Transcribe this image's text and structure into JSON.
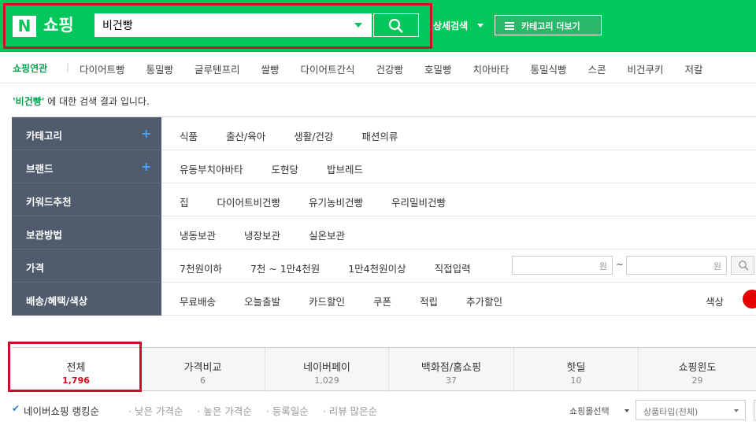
{
  "header": {
    "logo_letter": "N",
    "logo_text": "쇼핑",
    "search_value": "비건빵",
    "detail_search": "상세검색",
    "category_more": "카테고리 더보기"
  },
  "related": {
    "title": "쇼핑연관",
    "separator": "|",
    "items": [
      "다이어트빵",
      "통밀빵",
      "글루텐프리",
      "쌀빵",
      "다이어트간식",
      "건강빵",
      "호밀빵",
      "치아바타",
      "통밀식빵",
      "스콘",
      "비건쿠키",
      "저칼"
    ]
  },
  "result": {
    "keyword": "'비건빵'",
    "suffix": " 에 대한 검색 결과 입니다."
  },
  "filters": {
    "category": {
      "label": "카테고리",
      "plus": "+",
      "values": [
        "식품",
        "출산/육아",
        "생활/건강",
        "패션의류"
      ]
    },
    "brand": {
      "label": "브랜드",
      "plus": "+",
      "values": [
        "유동부치아바타",
        "도현당",
        "밥브레드"
      ]
    },
    "keyword": {
      "label": "키워드추천",
      "values": [
        "집",
        "다이어트비건빵",
        "유기농비건빵",
        "우리밀비건빵"
      ]
    },
    "storage": {
      "label": "보관방법",
      "values": [
        "냉동보관",
        "냉장보관",
        "실온보관"
      ]
    },
    "price": {
      "label": "가격",
      "values": [
        "7천원이하",
        "7천 ~ 1만4천원",
        "1만4천원이상",
        "직접입력"
      ],
      "unit1": "원",
      "tilde": "~",
      "unit2": "원"
    },
    "delivery": {
      "label": "배송/혜택/색상",
      "values": [
        "무료배송",
        "오늘출발",
        "카드할인",
        "쿠폰",
        "적립",
        "추가할인"
      ],
      "color_label": "색상"
    }
  },
  "tabs": [
    {
      "label": "전체",
      "count": "1,796"
    },
    {
      "label": "가격비교",
      "count": "6"
    },
    {
      "label": "네이버페이",
      "count": "1,029"
    },
    {
      "label": "백화점/홈쇼핑",
      "count": "37"
    },
    {
      "label": "핫딜",
      "count": "10"
    },
    {
      "label": "쇼핑윈도",
      "count": "29"
    }
  ],
  "sort": {
    "active": "네이버쇼핑 랭킹순",
    "others": [
      "· 낮은 가격순",
      "· 높은 가격순",
      "· 등록일순",
      "· 리뷰 많은순"
    ],
    "mall_select": "쇼핑몰선택",
    "type_select": "상품타입(전체)"
  },
  "colors": {
    "brand_green": "#03c75a",
    "filter_label_bg": "#505c6e",
    "highlight_red": "#c8102e",
    "count_red": "#e0001b"
  }
}
